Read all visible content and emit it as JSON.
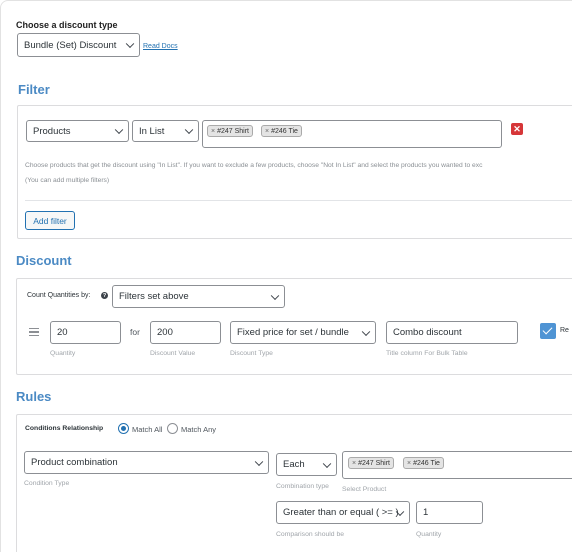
{
  "discount_type": {
    "label": "Choose a discount type",
    "value": "Bundle (Set) Discount",
    "read_docs": "Read Docs"
  },
  "filter": {
    "title": "Filter",
    "type_value": "Products",
    "method_value": "In List",
    "tags": [
      "#247 Shirt",
      "#246 Tie"
    ],
    "hint_line1": "Choose products that get the discount using \"In List\". If you want to exclude a few products, choose \"Not In List\" and select the products you wanted to exc",
    "hint_line2": "(You can add multiple filters)",
    "add_filter_label": "Add filter"
  },
  "discount": {
    "title": "Discount",
    "count_label": "Count Quantities by:",
    "count_value": "Filters set above",
    "quantity_value": "20",
    "for_label": "for",
    "discount_value": "200",
    "discount_type_value": "Fixed price for set / bundle",
    "title_value": "Combo discount",
    "checkbox_label": "Re",
    "sub_quantity": "Quantity",
    "sub_discount_value": "Discount Value",
    "sub_discount_type": "Discount Type",
    "sub_title": "Title column For Bulk Table"
  },
  "rules": {
    "title": "Rules",
    "relationship_label": "Conditions Relationship",
    "match_all": "Match All",
    "match_any": "Match Any",
    "condition_value": "Product combination",
    "condition_sub": "Condition Type",
    "combination_value": "Each",
    "combination_sub": "Combination type",
    "tags": [
      "#247 Shirt",
      "#246 Tie"
    ],
    "select_product_sub": "Select Product",
    "comparison_value": "Greater than or equal ( >= )",
    "comparison_sub": "Comparison should be",
    "quantity_value": "1",
    "quantity_sub": "Quantity"
  },
  "colors": {
    "section_title": "#4b8ac4",
    "link": "#2271b1",
    "delete": "#d63638",
    "checkbox": "#4f94d4"
  },
  "icons": {
    "delete": "close-icon",
    "drag": "drag-handle-icon",
    "help": "question-icon",
    "dropdown": "chevron-down-icon"
  }
}
